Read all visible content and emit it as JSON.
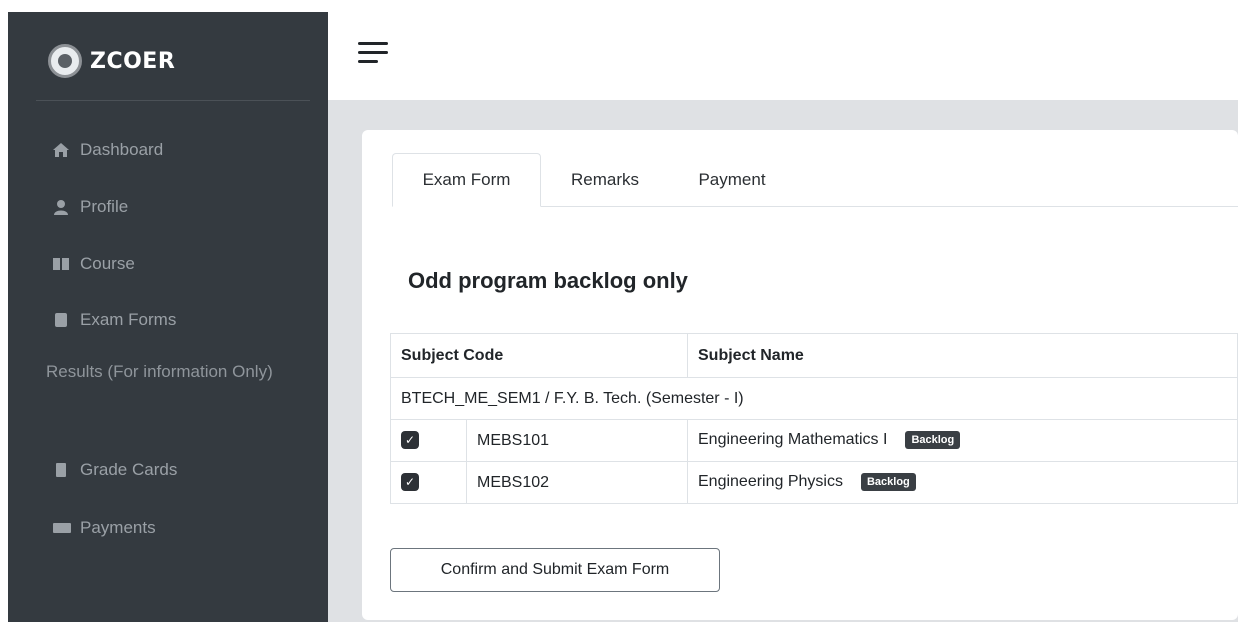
{
  "brand": {
    "name": "ZCOER"
  },
  "sidebar": {
    "items": [
      {
        "label": "Dashboard",
        "icon": "home-icon"
      },
      {
        "label": "Profile",
        "icon": "user-icon"
      },
      {
        "label": "Course",
        "icon": "book-icon"
      },
      {
        "label": "Exam Forms",
        "icon": "file-icon"
      }
    ],
    "heading": "Results (For information Only)",
    "items2": [
      {
        "label": "Grade Cards",
        "icon": "document-icon"
      },
      {
        "label": "Payments",
        "icon": "money-icon"
      }
    ]
  },
  "tabs": [
    {
      "label": "Exam Form",
      "active": true
    },
    {
      "label": "Remarks",
      "active": false
    },
    {
      "label": "Payment",
      "active": false
    }
  ],
  "main": {
    "title": "Odd program backlog only",
    "table": {
      "headers": [
        "Subject Code",
        "Subject Name"
      ],
      "group": "BTECH_ME_SEM1 / F.Y. B. Tech. (Semester - I)",
      "rows": [
        {
          "checked": true,
          "code": "MEBS101",
          "name": "Engineering Mathematics I",
          "badge": "Backlog"
        },
        {
          "checked": true,
          "code": "MEBS102",
          "name": "Engineering Physics",
          "badge": "Backlog"
        }
      ]
    },
    "submit_label": "Confirm and Submit Exam Form"
  }
}
